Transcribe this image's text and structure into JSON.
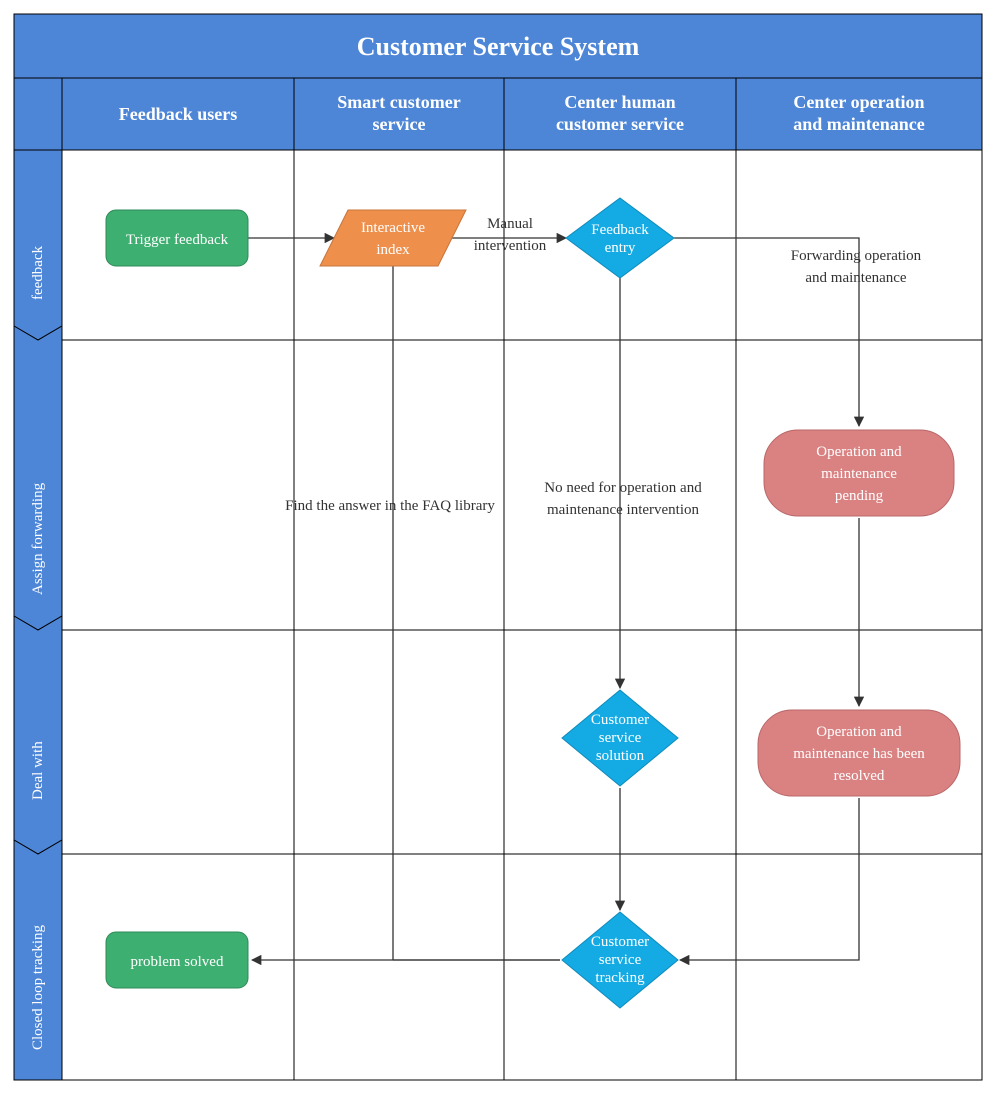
{
  "colors": {
    "blue": "#4E86D7",
    "green": "#3DAF70",
    "orange": "#EE8F4C",
    "cyan": "#14AAE4",
    "pink": "#DA8182",
    "line": "#333333",
    "grid": "#000000"
  },
  "title": "Customer Service System",
  "columns": [
    "Feedback users",
    "Smart customer service",
    "Center human customer service",
    "Center operation and maintenance"
  ],
  "rows": [
    "feedback",
    "Assign forwarding",
    "Deal with",
    "Closed loop tracking"
  ],
  "nodes": {
    "trigger": "Trigger feedback",
    "index1": "Interactive",
    "index2": "index",
    "fbentry1": "Feedback",
    "fbentry2": "entry",
    "pend1": "Operation and",
    "pend2": "maintenance",
    "pend3": "pending",
    "cssol1": "Customer",
    "cssol2": "service",
    "cssol3": "solution",
    "res1": "Operation and",
    "res2": "maintenance has been",
    "res3": "resolved",
    "cstrack1": "Customer",
    "cstrack2": "service",
    "cstrack3": "tracking",
    "solved": "problem solved"
  },
  "labels": {
    "manual1": "Manual",
    "manual2": "intervention",
    "fwd1": "Forwarding operation",
    "fwd2": "and maintenance",
    "faq": "Find the answer in the FAQ library",
    "noneed1": "No need for operation and",
    "noneed2": "maintenance intervention"
  },
  "chart_data": {
    "type": "flowchart-swimlane",
    "title": "Customer Service System",
    "lanes": [
      "Feedback users",
      "Smart customer service",
      "Center human customer service",
      "Center operation and maintenance"
    ],
    "phases": [
      "feedback",
      "Assign forwarding",
      "Deal with",
      "Closed loop tracking"
    ],
    "nodes": [
      {
        "id": "trigger",
        "label": "Trigger feedback",
        "shape": "rounded-rect",
        "lane": "Feedback users",
        "phase": "feedback",
        "color": "green"
      },
      {
        "id": "index",
        "label": "Interactive index",
        "shape": "parallelogram",
        "lane": "Smart customer service",
        "phase": "feedback",
        "color": "orange"
      },
      {
        "id": "fbentry",
        "label": "Feedback entry",
        "shape": "diamond",
        "lane": "Center human customer service",
        "phase": "feedback",
        "color": "cyan"
      },
      {
        "id": "pending",
        "label": "Operation and maintenance pending",
        "shape": "rounded-rect",
        "lane": "Center operation and maintenance",
        "phase": "Assign forwarding",
        "color": "pink"
      },
      {
        "id": "cssol",
        "label": "Customer service solution",
        "shape": "diamond",
        "lane": "Center human customer service",
        "phase": "Deal with",
        "color": "cyan"
      },
      {
        "id": "resolved",
        "label": "Operation and maintenance has been resolved",
        "shape": "rounded-rect",
        "lane": "Center operation and maintenance",
        "phase": "Deal with",
        "color": "pink"
      },
      {
        "id": "cstrack",
        "label": "Customer service tracking",
        "shape": "diamond",
        "lane": "Center human customer service",
        "phase": "Closed loop tracking",
        "color": "cyan"
      },
      {
        "id": "solved",
        "label": "problem solved",
        "shape": "rounded-rect",
        "lane": "Feedback users",
        "phase": "Closed loop tracking",
        "color": "green"
      }
    ],
    "edges": [
      {
        "from": "trigger",
        "to": "index"
      },
      {
        "from": "index",
        "to": "fbentry",
        "label": "Manual intervention"
      },
      {
        "from": "fbentry",
        "to": "pending",
        "label": "Forwarding operation and maintenance"
      },
      {
        "from": "index",
        "to": "cstrack",
        "label": "Find the answer in the FAQ library"
      },
      {
        "from": "fbentry",
        "to": "cssol",
        "label": "No need for operation and maintenance intervention"
      },
      {
        "from": "pending",
        "to": "resolved"
      },
      {
        "from": "cssol",
        "to": "cstrack"
      },
      {
        "from": "resolved",
        "to": "cstrack"
      },
      {
        "from": "cstrack",
        "to": "solved"
      }
    ]
  }
}
